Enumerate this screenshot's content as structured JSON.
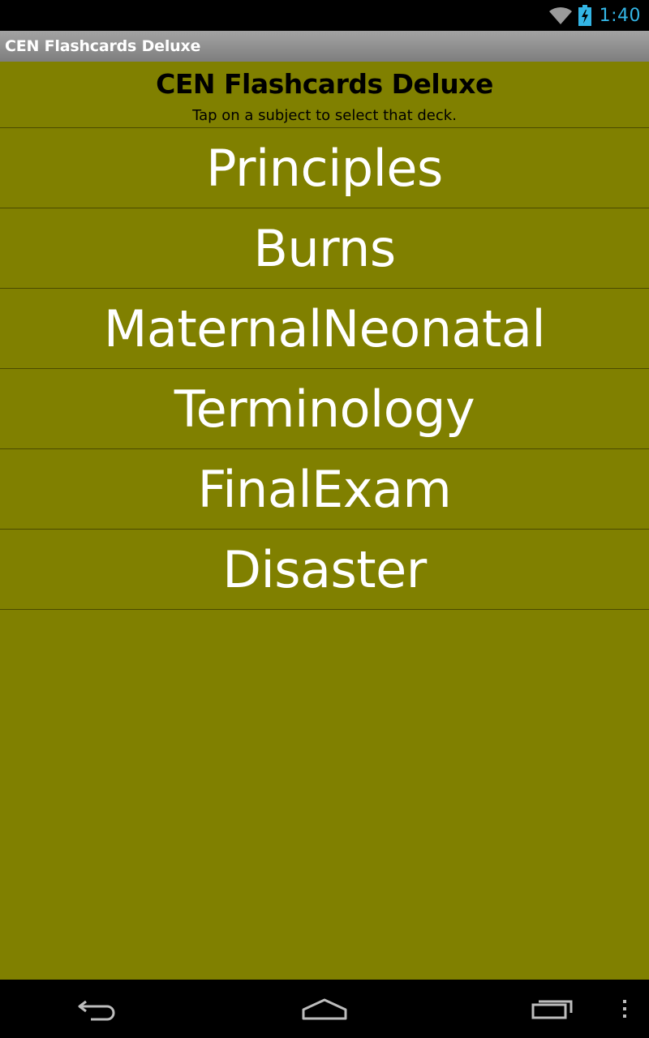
{
  "status_bar": {
    "time": "1:40",
    "icons": [
      "wifi-icon",
      "battery-charging-icon"
    ]
  },
  "title_bar": {
    "title": "CEN Flashcards Deluxe"
  },
  "header": {
    "title": "CEN Flashcards Deluxe",
    "subtitle": "Tap on a subject to select that deck."
  },
  "decks": [
    {
      "label": "Principles"
    },
    {
      "label": "Burns"
    },
    {
      "label": "MaternalNeonatal"
    },
    {
      "label": "Terminology"
    },
    {
      "label": "FinalExam"
    },
    {
      "label": "Disaster"
    }
  ],
  "nav_bar": {
    "icons": [
      "back-icon",
      "home-icon",
      "recents-icon",
      "overflow-menu-icon"
    ]
  },
  "colors": {
    "content_background": "#808000",
    "clock": "#33b5e5",
    "deck_text": "#ffffff",
    "divider": "#4a4a00"
  }
}
